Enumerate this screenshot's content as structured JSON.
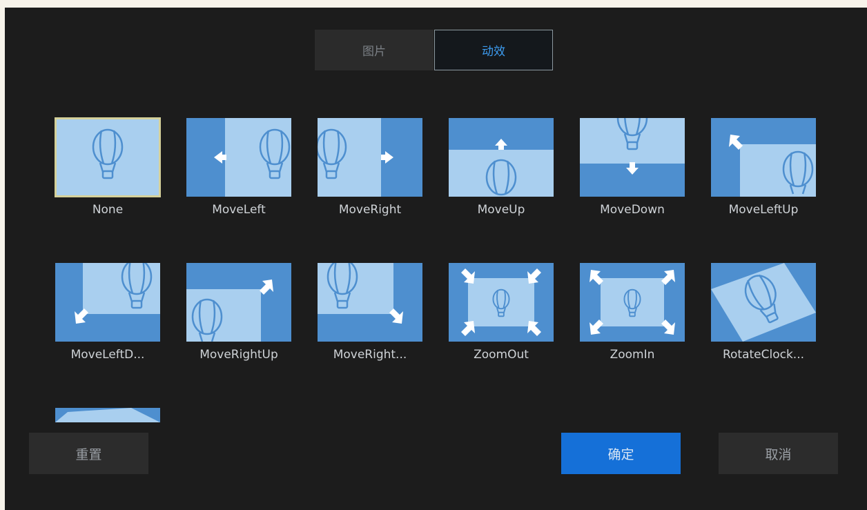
{
  "tabs": [
    {
      "label": "图片",
      "active": false
    },
    {
      "label": "动效",
      "active": true
    }
  ],
  "effects": [
    {
      "label": "None",
      "selected": true
    },
    {
      "label": "MoveLeft"
    },
    {
      "label": "MoveRight"
    },
    {
      "label": "MoveUp"
    },
    {
      "label": "MoveDown"
    },
    {
      "label": "MoveLeftUp"
    },
    {
      "label": "MoveLeftD..."
    },
    {
      "label": "MoveRightUp"
    },
    {
      "label": "MoveRight..."
    },
    {
      "label": "ZoomOut"
    },
    {
      "label": "ZoomIn"
    },
    {
      "label": "RotateClock..."
    }
  ],
  "buttons": {
    "reset": "重置",
    "ok": "确定",
    "cancel": "取消"
  },
  "colors": {
    "thumb_dark": "#4e8fcf",
    "thumb_light": "#a9cfef",
    "accent": "#1570d8",
    "selected_outline": "#d5d19a"
  }
}
